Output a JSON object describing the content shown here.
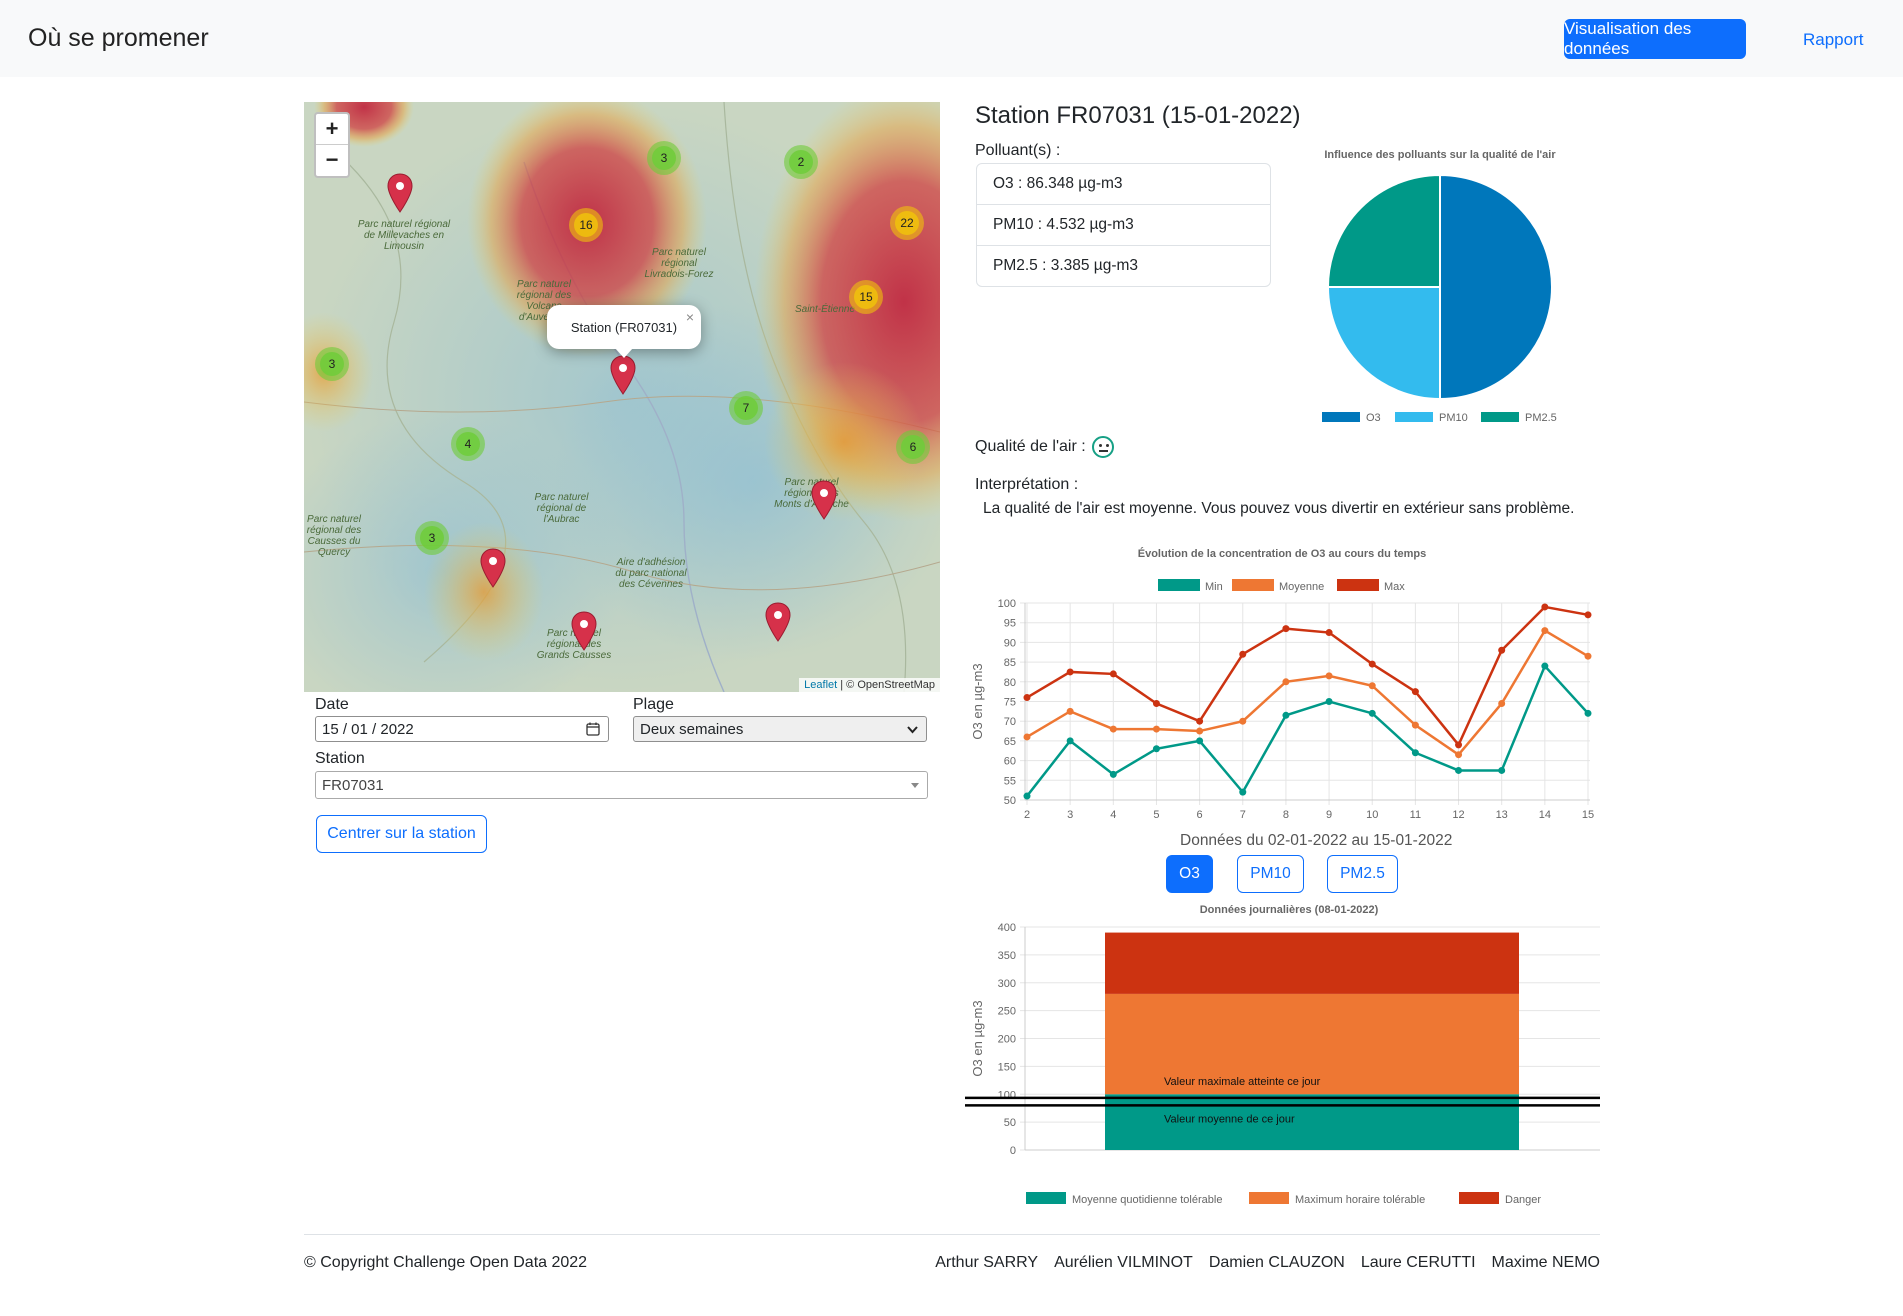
{
  "navbar": {
    "brand": "Où se promener",
    "viz_button": "Visualisation des données",
    "report_link": "Rapport"
  },
  "map": {
    "zoom_in": "+",
    "zoom_out": "−",
    "popup_text": "Station (FR07031)",
    "popup_close": "×",
    "attribution_leaflet": "Leaflet",
    "attribution_osm": "| © OpenStreetMap",
    "clusters": [
      "3",
      "2",
      "16",
      "22",
      "15",
      "3",
      "7",
      "4",
      "6",
      "3"
    ],
    "labels": [
      "Parc naturel régional de Millevaches en Limousin",
      "Parc naturel régional Livradois-Forez",
      "Parc naturel régional des Volcans d'Auvergne",
      "Saint-Étienne",
      "Parc naturel régional de l'Aubrac",
      "Parc naturel régional des Causses du Quercy",
      "Aire d'adhésion du parc national des Cévennes",
      "Parc naturel régional des Grands Causses",
      "Parc naturel régional des Monts d'Ardèche"
    ]
  },
  "form": {
    "date_label": "Date",
    "date_value": "15 / 01 / 2022",
    "range_label": "Plage",
    "range_value": "Deux semaines",
    "station_label": "Station",
    "station_value": "FR07031",
    "center_button": "Centrer sur la station"
  },
  "station": {
    "title": "Station FR07031 (15-01-2022)",
    "pollutants_label": "Polluant(s) :",
    "pollutants": [
      "O3 : 86.348 µg-m3",
      "PM10 : 4.532 µg-m3",
      "PM2.5 : 3.385 µg-m3"
    ],
    "quality_label": "Qualité de l'air :",
    "interpretation_label": "Interprétation :",
    "interpretation_text": "La qualité de l'air est moyenne. Vous pouvez vous divertir en extérieur sans problème.",
    "range_text": "Données du 02-01-2022 au 15-01-2022",
    "pollutant_buttons": [
      "O3",
      "PM10",
      "PM2.5"
    ],
    "active_pollutant": "O3"
  },
  "colors": {
    "primary": "#0d6efd",
    "o3": "#0077bb",
    "pm10": "#33bbee",
    "pm25": "#009988",
    "min": "#009988",
    "avg": "#ee7733",
    "max": "#cc3311"
  },
  "chart_data": [
    {
      "type": "pie",
      "title": "Influence des polluants sur la qualité de l'air",
      "categories": [
        "O3",
        "PM10",
        "PM2.5"
      ],
      "values": [
        50,
        25,
        25
      ],
      "legend": "bottom"
    },
    {
      "type": "line",
      "title": "Évolution de la concentration de O3 au cours du temps",
      "ylabel": "O3 en µg-m3",
      "x": [
        2,
        3,
        4,
        5,
        6,
        7,
        8,
        9,
        10,
        11,
        12,
        13,
        14,
        15
      ],
      "ylim": [
        50,
        100
      ],
      "yticks": [
        50,
        55,
        60,
        65,
        70,
        75,
        80,
        85,
        90,
        95,
        100
      ],
      "legend": "top",
      "series": [
        {
          "name": "Min",
          "values": [
            51,
            65,
            56.5,
            63,
            65,
            52,
            71.5,
            75,
            72,
            62,
            57.5,
            57.5,
            84,
            72
          ]
        },
        {
          "name": "Moyenne",
          "values": [
            66,
            72.5,
            68,
            68,
            67.5,
            70,
            80,
            81.5,
            79,
            69,
            61.5,
            74.5,
            93,
            86.5
          ]
        },
        {
          "name": "Max",
          "values": [
            76,
            82.5,
            82,
            74.5,
            70,
            87,
            93.5,
            92.5,
            84.5,
            77.5,
            64,
            88,
            99,
            97
          ]
        }
      ]
    },
    {
      "type": "bar",
      "title": "Données journalières (08-01-2022)",
      "ylabel": "O3 en µg-m3",
      "ylim": [
        0,
        400
      ],
      "yticks": [
        0,
        50,
        100,
        150,
        200,
        250,
        300,
        350,
        400
      ],
      "legend": "bottom",
      "series": [
        {
          "name": "Moyenne quotidienne tolérable",
          "values": [
            100
          ]
        },
        {
          "name": "Maximum horaire tolérable",
          "values": [
            180
          ]
        },
        {
          "name": "Danger",
          "values": [
            110
          ]
        }
      ],
      "annotations": [
        {
          "label": "Valeur maximale atteinte ce jour",
          "value": 93.5
        },
        {
          "label": "Valeur moyenne de ce jour",
          "value": 80
        }
      ]
    }
  ],
  "footer": {
    "copyright": "© Copyright Challenge Open Data 2022",
    "authors": [
      "Arthur SARRY",
      "Aurélien VILMINOT",
      "Damien CLAUZON",
      "Laure CERUTTI",
      "Maxime NEMO"
    ]
  }
}
